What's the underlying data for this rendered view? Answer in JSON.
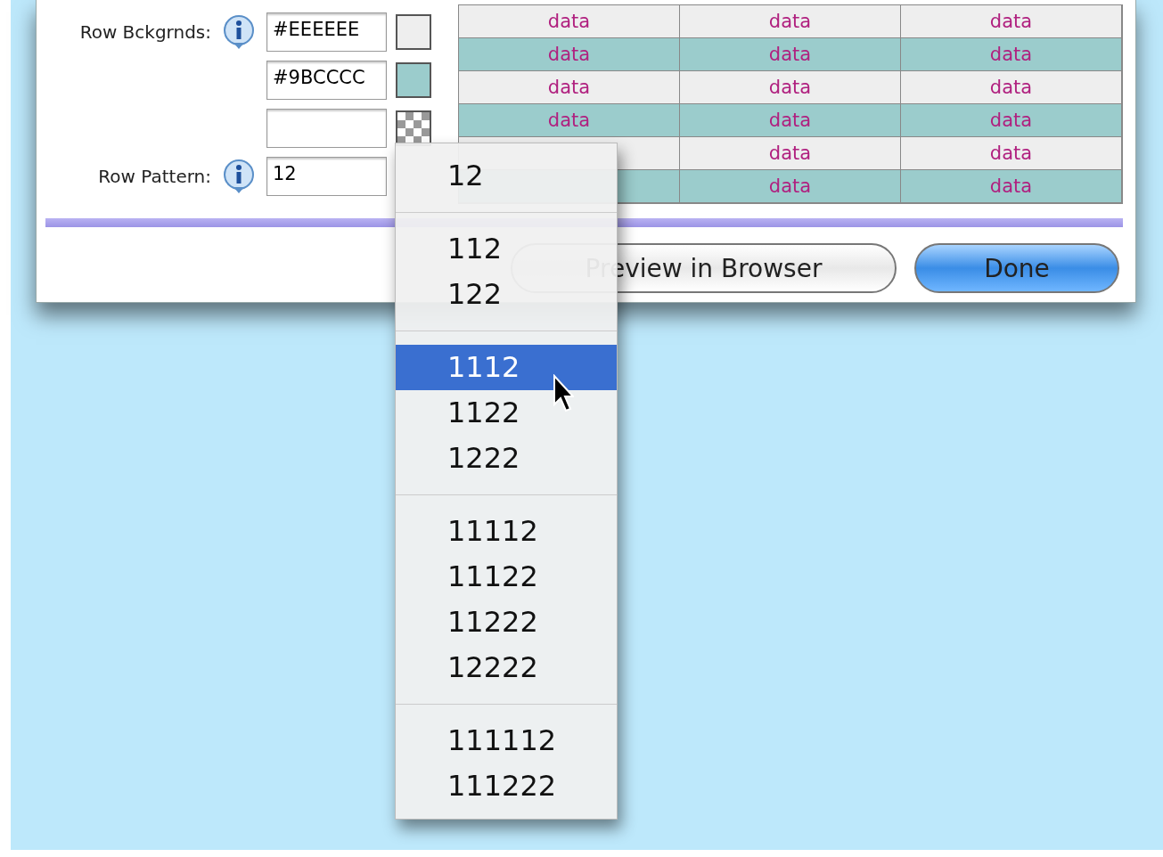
{
  "form": {
    "backgrounds_label": "Row Bckgrnds:",
    "backgrounds": [
      {
        "kind": "solid",
        "value": "#EEEEEE",
        "color": "#eeeeee"
      },
      {
        "kind": "solid",
        "value": "#9BCCCC",
        "color": "#9bcccc"
      },
      {
        "kind": "empty"
      }
    ],
    "pattern_label": "Row Pattern:",
    "pattern_value": "12"
  },
  "table": {
    "rows": [
      [
        "data",
        "data",
        "data"
      ],
      [
        "data",
        "data",
        "data"
      ],
      [
        "data",
        "data",
        "data"
      ],
      [
        "data",
        "data",
        "data"
      ],
      [
        null,
        "data",
        "data"
      ],
      [
        null,
        "data",
        "data"
      ]
    ]
  },
  "buttons": [
    {
      "label": "Preview in Browser",
      "default": false
    },
    {
      "label": "Done",
      "default": true
    }
  ],
  "menu": {
    "groups": [
      [
        {
          "label": "12",
          "selected": false
        }
      ],
      [
        {
          "label": "112",
          "selected": false
        },
        {
          "label": "122",
          "selected": false
        }
      ],
      [
        {
          "label": "1112",
          "selected": true
        },
        {
          "label": "1122",
          "selected": false
        },
        {
          "label": "1222",
          "selected": false
        }
      ],
      [
        {
          "label": "11112",
          "selected": false
        },
        {
          "label": "11122",
          "selected": false
        },
        {
          "label": "11222",
          "selected": false
        },
        {
          "label": "12222",
          "selected": false
        }
      ],
      [
        {
          "label": "111112",
          "selected": false
        },
        {
          "label": "111222",
          "selected": false
        }
      ]
    ]
  }
}
